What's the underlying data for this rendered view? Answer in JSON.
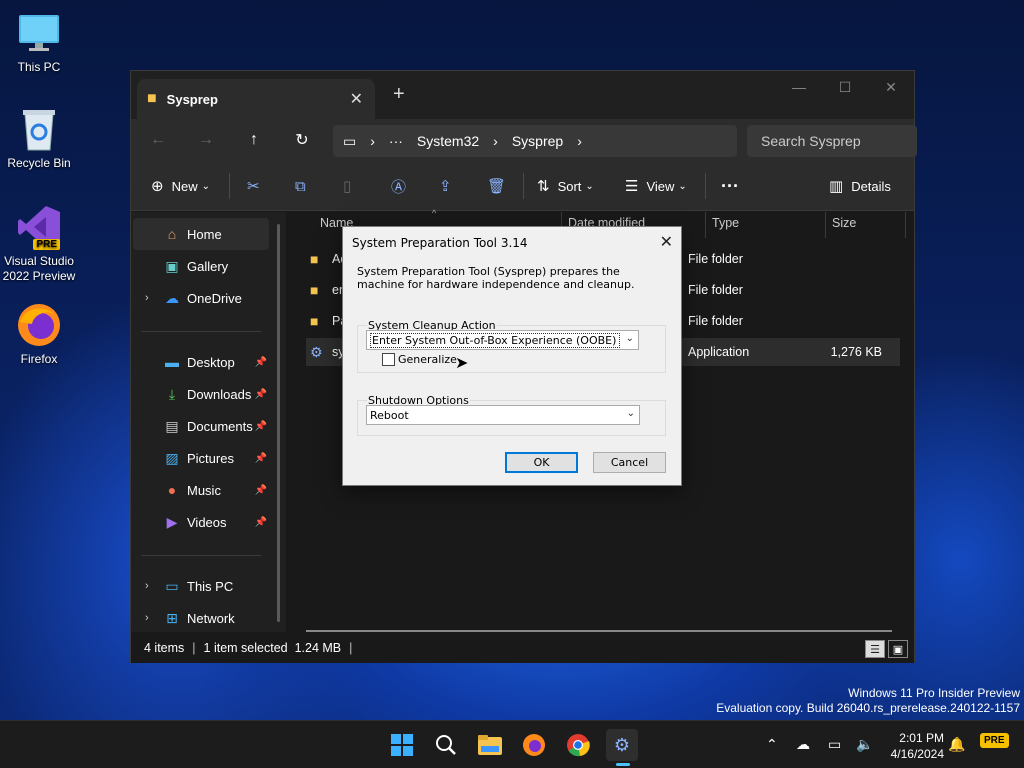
{
  "desktop": {
    "icons": [
      {
        "label": "This PC",
        "icon": "monitor-icon"
      },
      {
        "label": "Recycle Bin",
        "icon": "recycle-bin-icon"
      },
      {
        "label": "Visual Studio 2022 Preview",
        "icon": "visual-studio-icon",
        "badge": "PRE"
      },
      {
        "label": "Firefox",
        "icon": "firefox-icon"
      }
    ]
  },
  "explorer": {
    "tab_title": "Sysprep",
    "breadcrumb": [
      "System32",
      "Sysprep"
    ],
    "search_placeholder": "Search Sysprep",
    "commands": {
      "new": "New",
      "sort": "Sort",
      "view": "View",
      "details": "Details"
    },
    "nav": {
      "home": "Home",
      "gallery": "Gallery",
      "onedrive": "OneDrive",
      "desktop": "Desktop",
      "downloads": "Downloads",
      "documents": "Documents",
      "pictures": "Pictures",
      "music": "Music",
      "videos": "Videos",
      "this_pc": "This PC",
      "network": "Network"
    },
    "columns": {
      "name": "Name",
      "date_modified": "Date modified",
      "type": "Type",
      "size": "Size"
    },
    "files": [
      {
        "name": "Ac",
        "type": "File folder",
        "size": ""
      },
      {
        "name": "en-",
        "type": "File folder",
        "size": ""
      },
      {
        "name": "Pa",
        "type": "File folder",
        "size": ""
      },
      {
        "name": "sys",
        "type": "Application",
        "size": "1,276 KB"
      }
    ],
    "status": {
      "items": "4 items",
      "selected": "1 item selected  1.24 MB"
    }
  },
  "dialog": {
    "title": "System Preparation Tool 3.14",
    "description": "System Preparation Tool (Sysprep) prepares the machine for hardware independence and cleanup.",
    "cleanup_label": "System Cleanup Action",
    "cleanup_value": "Enter System Out-of-Box Experience (OOBE)",
    "generalize_label": "Generalize",
    "generalize_checked": false,
    "shutdown_label": "Shutdown Options",
    "shutdown_value": "Reboot",
    "ok": "OK",
    "cancel": "Cancel"
  },
  "watermark": {
    "line1": "Windows 11 Pro Insider Preview",
    "line2": "Evaluation copy. Build 26040.rs_prerelease.240122-1157"
  },
  "taskbar": {
    "time": "2:01 PM",
    "date": "4/16/2024",
    "apps": [
      "start-icon",
      "search-icon",
      "file-explorer-icon",
      "firefox-icon",
      "chrome-icon",
      "sysprep-icon"
    ]
  },
  "colors": {
    "accent": "#0078d7",
    "folder": "#f5c350",
    "taskbar_indicator": "#4cc2ff"
  }
}
